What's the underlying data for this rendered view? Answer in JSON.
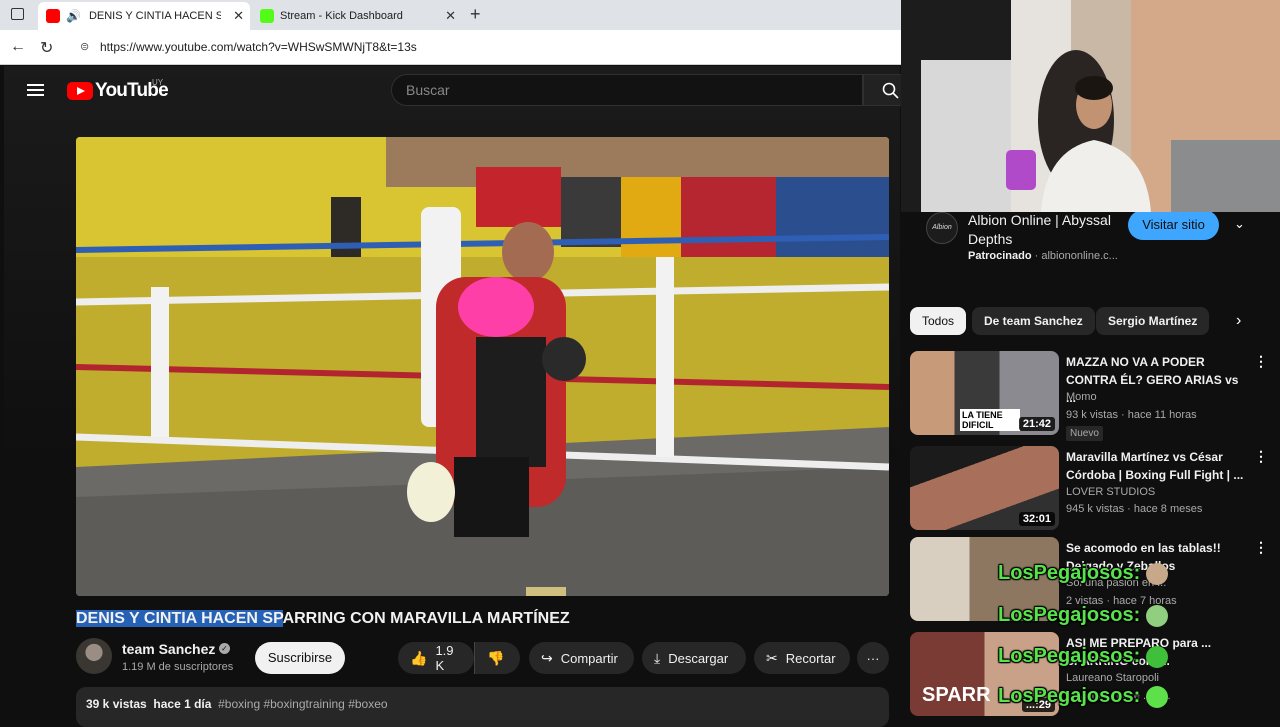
{
  "browser": {
    "tabs": [
      {
        "title": "DENIS Y CINTIA HACEN SPA",
        "active": true
      },
      {
        "title": "Stream - Kick Dashboard",
        "active": false
      }
    ],
    "url": "https://www.youtube.com/watch?v=WHSwSMWNjT8&t=13s"
  },
  "header": {
    "logo_text": "YouTube",
    "country": "UY",
    "search_placeholder": "Buscar"
  },
  "video": {
    "title_selected": "DENIS Y CINTIA HACEN SP",
    "title_rest": "ARRING CON MARAVILLA MARTÍNEZ",
    "channel": "team Sanchez",
    "verified_mark": "✓",
    "subscribers": "1.19 M de suscriptores",
    "subscribe_label": "Suscribirse",
    "likes": "1.9 K",
    "share_label": "Compartir",
    "download_label": "Descargar",
    "clip_label": "Recortar",
    "more_label": "···",
    "views": "39 k vistas",
    "age": "hace 1 día",
    "tags": "#boxing #boxingtraining #boxeo"
  },
  "sidebar": {
    "ad": {
      "title": "Albion Online | Abyssal Depths",
      "sponsored": "Patrocinado",
      "domain": "albiononline.c...",
      "logo_text": "Albion",
      "visit_label": "Visitar sitio"
    },
    "chips": [
      "Todos",
      "De team Sanchez",
      "Sergio Martínez"
    ],
    "recommendations": [
      {
        "title": "MAZZA NO VA A PODER CONTRA ÉL? GERO ARIAS vs ...",
        "channel": "Momo",
        "meta": "93 k vistas · hace 11 horas",
        "badge": "Nuevo",
        "duration": "21:42",
        "thumb_text": "LA TIENE DIFICIL"
      },
      {
        "title": "Maravilla Martínez vs César Córdoba | Boxing Full Fight | ...",
        "channel": "LOVER STUDIOS",
        "meta": "945 k vistas · hace 8 meses",
        "duration": "32:01"
      },
      {
        "title": "Se acomodo en las tablas!! Delgado y Zeballos",
        "channel": "Sol una pasión en ...",
        "meta": "2 vistas · hace 7 horas",
        "duration": ""
      },
      {
        "title": "ASI ME PREPARO para ... SPARRING con l...",
        "channel": "Laureano Staropoli",
        "meta": "... vistas · hace ...1 ...",
        "duration": "...:29",
        "thumb_text": "SPARR"
      }
    ]
  },
  "chat_overlay": [
    "LosPegajosos:",
    "LosPegajosos:",
    "LosPegajosos:",
    "LosPegajosos:"
  ]
}
